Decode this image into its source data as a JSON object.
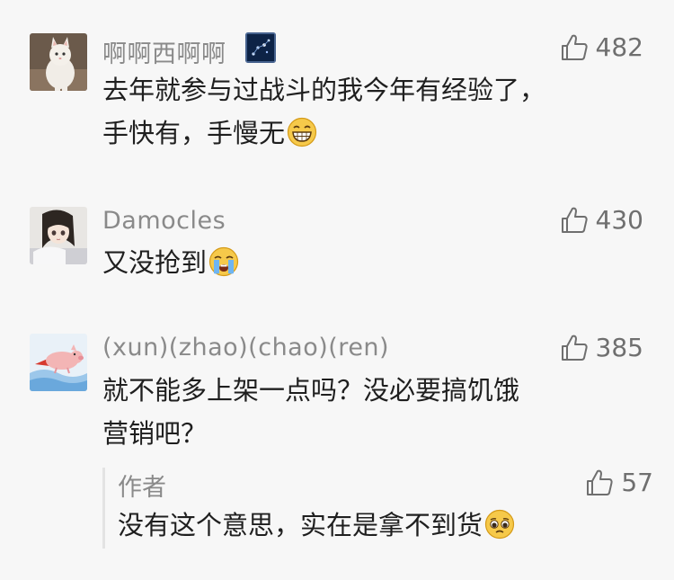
{
  "comments": [
    {
      "nickname": "啊啊西啊啊",
      "likes": "482",
      "lines": [
        "去年就参与过战斗的我今年有经验了，",
        "手快有，手慢无"
      ],
      "emoji": "grinning-face-emoji",
      "has_badge": true
    },
    {
      "nickname": "Damocles",
      "likes": "430",
      "lines": [
        "又没抢到"
      ],
      "emoji": "crying-face-emoji"
    },
    {
      "nickname": "(xun)(zhao)(chao)(ren)",
      "likes": "385",
      "lines": [
        "就不能多上架一点吗？没必要搞饥饿",
        "营销吧？"
      ]
    }
  ],
  "reply": {
    "author": "作者",
    "likes": "57",
    "text": "没有这个意思，实在是拿不到货",
    "emoji": "pleading-face-emoji"
  },
  "icons": {
    "like": "thumbs-up-icon"
  },
  "colors": {
    "background": "#f7f7f7",
    "secondary_text": "#8a8a8a",
    "primary_text": "#1f1f1f"
  }
}
